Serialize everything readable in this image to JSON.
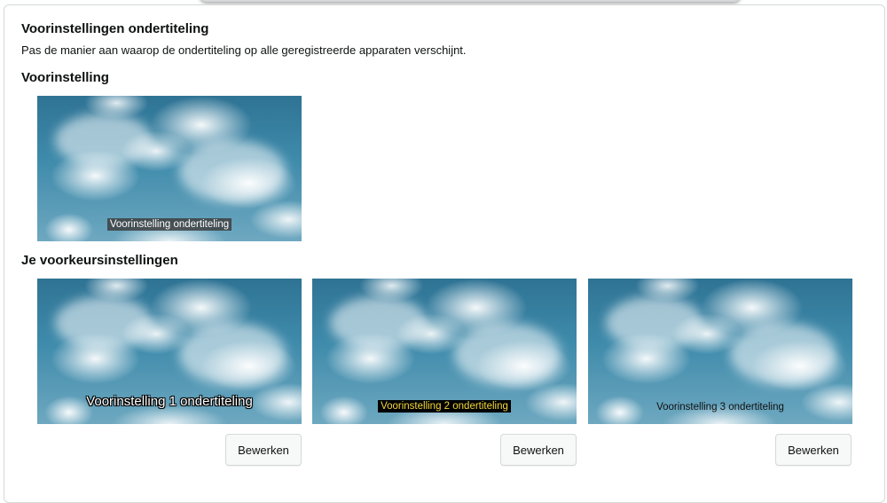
{
  "header": {
    "title": "Voorinstellingen ondertiteling",
    "description": "Pas de manier aan waarop de ondertiteling op alle geregistreerde apparaten verschijnt."
  },
  "default_section": {
    "title": "Voorinstelling",
    "preview_caption": "Voorinstelling ondertiteling"
  },
  "preferences_section": {
    "title": "Je voorkeursinstellingen",
    "presets": [
      {
        "caption": "Voorinstelling 1 ondertiteling",
        "edit_label": "Bewerken"
      },
      {
        "caption": "Voorinstelling 2 ondertiteling",
        "edit_label": "Bewerken"
      },
      {
        "caption": "Voorinstelling 3 ondertiteling",
        "edit_label": "Bewerken"
      }
    ]
  },
  "colors": {
    "sky": "#3f8bab",
    "caption_box_dark": "#3c3c3c",
    "caption_yellow": "#f3d83a",
    "button_bg": "#f7f8f8",
    "border": "#d5d9d9"
  }
}
